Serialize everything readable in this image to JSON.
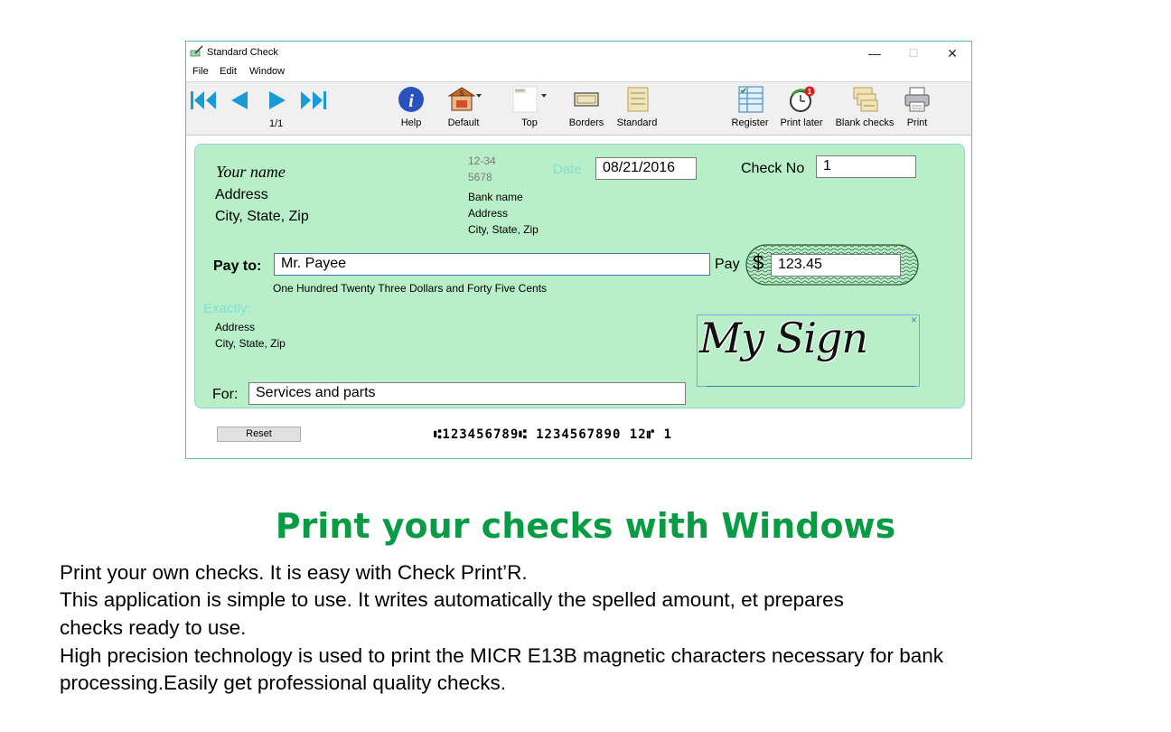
{
  "window": {
    "title": "Standard Check",
    "controls": {
      "minimize": "—",
      "maximize": "☐",
      "close": "✕"
    },
    "menu": [
      "File",
      "Edit",
      "Window"
    ]
  },
  "toolbar": {
    "page_counter": "1/1",
    "help": "Help",
    "default": "Default",
    "top": "Top",
    "borders": "Borders",
    "standard": "Standard",
    "register": "Register",
    "print_later": "Print later",
    "print_later_badge": "1",
    "blank_checks": "Blank checks",
    "print": "Print"
  },
  "check": {
    "your_name": "Your name",
    "address": "Address",
    "city_state_zip": "City, State, Zip",
    "routing_top": "12-34",
    "routing_bottom": "5678",
    "bank_name": "Bank name",
    "bank_address": "Address",
    "bank_city": "City, State, Zip",
    "date_label": "Date",
    "date_value": "08/21/2016",
    "check_no_label": "Check No",
    "check_no_value": "1",
    "pay_to_label": "Pay to:",
    "payee_value": "Mr. Payee",
    "pay_label": "Pay",
    "dollar_sign": "$",
    "amount_value": "123.45",
    "spelled_amount": "One Hundred Twenty Three Dollars and Forty Five Cents",
    "exactly_label": "Exactly:",
    "payee_address": "Address",
    "payee_city": "City, State, Zip",
    "signature": "My Sign",
    "signature_close": "×",
    "for_label": "For:",
    "memo_value": "Services and parts"
  },
  "reset_button": "Reset",
  "micr_line": "⑆123456789⑆ 1234567890 12⑈   1",
  "marketing": {
    "headline": "Print your checks with Windows",
    "lines": [
      "Print your own checks. It is easy with Check Print’R.",
      "This application is simple to use. It writes automatically the spelled amount, et prepares",
      "checks ready to use.",
      "High precision technology is used to print the MICR E13B magnetic characters necessary for bank",
      "processing.Easily get professional quality checks."
    ]
  },
  "colors": {
    "check_background": "#b8eec8",
    "accent_blue": "#1a9ad6",
    "headline_green": "#0a9b45",
    "faint_label": "#7fe0d8"
  }
}
